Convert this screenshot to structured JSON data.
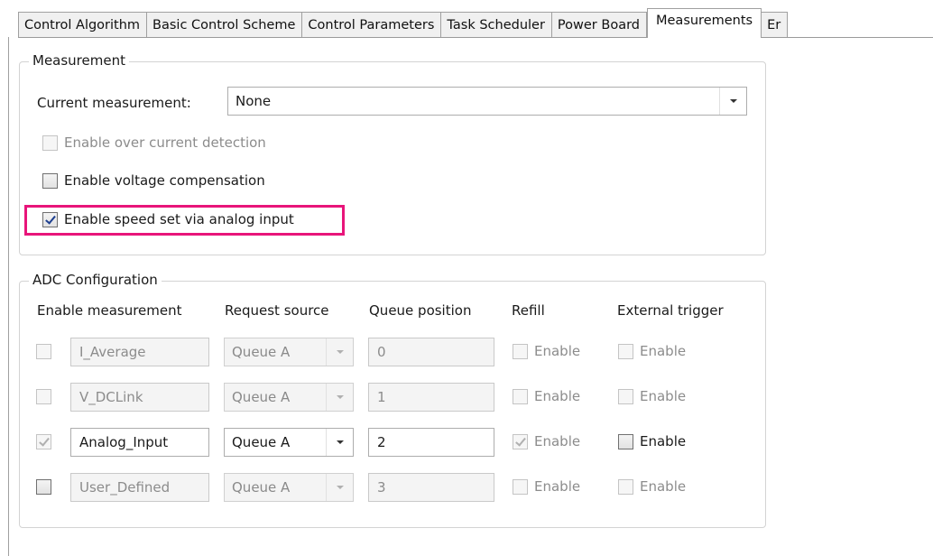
{
  "tabs": [
    {
      "label": "Control Algorithm",
      "active": false
    },
    {
      "label": "Basic Control Scheme",
      "active": false
    },
    {
      "label": "Control Parameters",
      "active": false
    },
    {
      "label": "Task Scheduler",
      "active": false
    },
    {
      "label": "Power Board",
      "active": false
    },
    {
      "label": "Measurements",
      "active": true
    },
    {
      "label": "Er",
      "active": false
    }
  ],
  "measurement": {
    "title": "Measurement",
    "current_label": "Current measurement:",
    "current_value": "None",
    "over_current": {
      "label": "Enable over current detection",
      "checked": false,
      "enabled": false
    },
    "voltage_comp": {
      "label": "Enable voltage compensation",
      "checked": false,
      "enabled": true
    },
    "speed_analog": {
      "label": "Enable speed set via analog input",
      "checked": true,
      "enabled": true
    },
    "highlight_color": "#e8157a"
  },
  "adc": {
    "title": "ADC Configuration",
    "headers": {
      "enable": "Enable measurement",
      "request": "Request source",
      "queue": "Queue position",
      "refill": "Refill",
      "trigger": "External trigger"
    },
    "rows": [
      {
        "name": "I_Average",
        "enabled_meas": false,
        "source": "Queue A",
        "position": "0",
        "refill_label": "Enable",
        "refill": false,
        "trigger_label": "Enable",
        "trigger": false,
        "active": false
      },
      {
        "name": "V_DCLink",
        "enabled_meas": false,
        "source": "Queue A",
        "position": "1",
        "refill_label": "Enable",
        "refill": false,
        "trigger_label": "Enable",
        "trigger": false,
        "active": false
      },
      {
        "name": "Analog_Input",
        "enabled_meas": true,
        "source": "Queue A",
        "position": "2",
        "refill_label": "Enable",
        "refill": true,
        "trigger_label": "Enable",
        "trigger": false,
        "active": true
      },
      {
        "name": "User_Defined",
        "enabled_meas": false,
        "source": "Queue A",
        "position": "3",
        "refill_label": "Enable",
        "refill": false,
        "trigger_label": "Enable",
        "trigger": false,
        "active": false
      }
    ]
  }
}
